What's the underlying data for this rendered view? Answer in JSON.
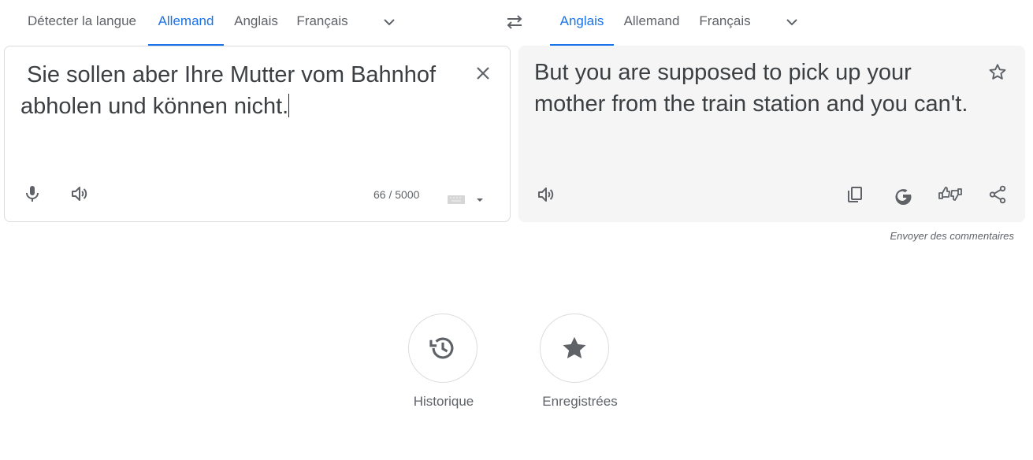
{
  "source_langs": {
    "detect": "Détecter la langue",
    "lang1": "Allemand",
    "lang2": "Anglais",
    "lang3": "Français"
  },
  "target_langs": {
    "lang1": "Anglais",
    "lang2": "Allemand",
    "lang3": "Français"
  },
  "source": {
    "text": " Sie sollen aber Ihre Mutter vom Bahnhof\nabholen und können nicht.",
    "counter": "66 / 5000"
  },
  "target": {
    "text": "But you are supposed to pick up your mother from the train station and you can't."
  },
  "feedback": "Envoyer des commentaires",
  "shortcuts": {
    "history": "Historique",
    "saved": "Enregistrées"
  },
  "colors": {
    "accent": "#1a73e8",
    "icon": "#5f6368",
    "panel_bg": "#f5f5f5"
  },
  "icons": [
    "swap-icon",
    "chevron-down-icon",
    "close-icon",
    "microphone-icon",
    "speaker-icon",
    "keyboard-icon",
    "star-icon",
    "copy-icon",
    "google-icon",
    "feedback-thumbs-icon",
    "share-icon",
    "history-icon"
  ]
}
